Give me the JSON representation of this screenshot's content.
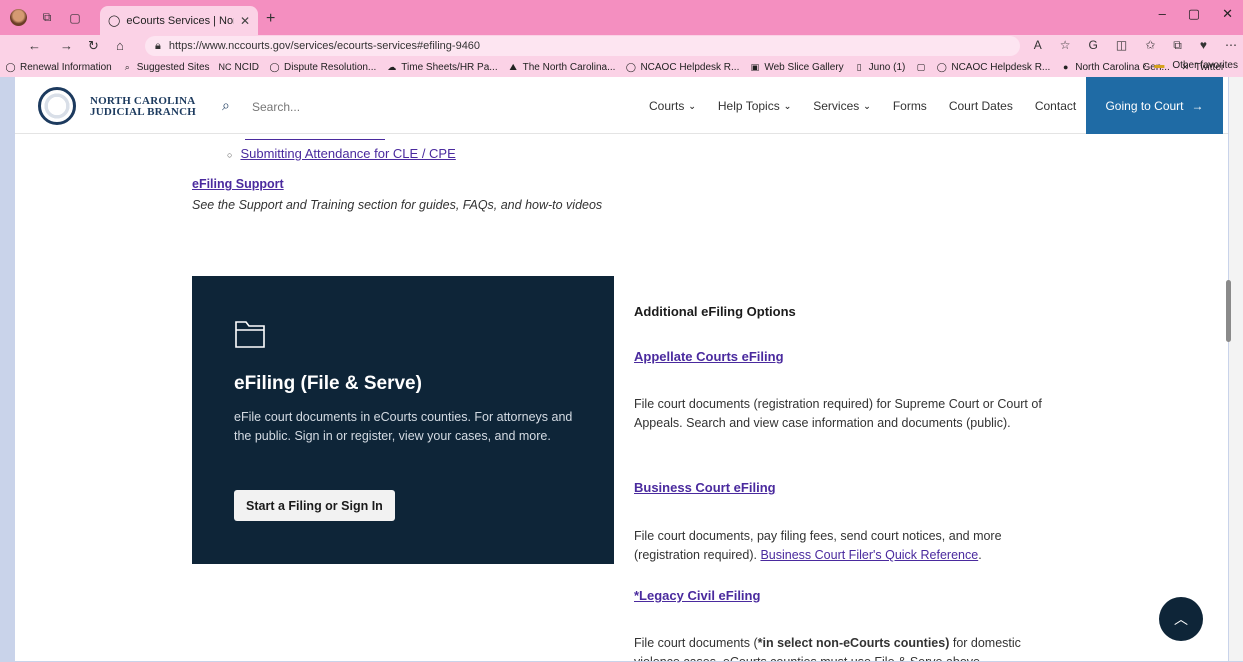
{
  "browser": {
    "tab_title": "eCourts Services | North Carolina",
    "url": "https://www.nccourts.gov/services/ecourts-services#efiling-9460",
    "favorites": [
      {
        "label": "Renewal Information",
        "icon": "globe-icon"
      },
      {
        "label": "Suggested Sites",
        "icon": "search-icon"
      },
      {
        "label": "NCID",
        "icon": "nc-icon"
      },
      {
        "label": "Dispute Resolution...",
        "icon": "globe-icon"
      },
      {
        "label": "Time Sheets/HR Pa...",
        "icon": "cloud-icon"
      },
      {
        "label": "The North Carolina...",
        "icon": "mountain-icon"
      },
      {
        "label": "NCAOC Helpdesk R...",
        "icon": "globe-icon"
      },
      {
        "label": "Web Slice Gallery",
        "icon": "slice-icon"
      },
      {
        "label": "Juno (1)",
        "icon": "page-icon"
      },
      {
        "label": "",
        "icon": "doc-icon"
      },
      {
        "label": "NCAOC Helpdesk R...",
        "icon": "globe-icon"
      },
      {
        "label": "North Carolina Gen...",
        "icon": "leaf-icon"
      },
      {
        "label": "Twitter",
        "icon": "x-icon"
      }
    ],
    "other_favorites": "Other favorites",
    "theme_color": "#f48fc0"
  },
  "header": {
    "brand_line1": "NORTH CAROLINA",
    "brand_line2": "JUDICIAL BRANCH",
    "search_placeholder": "Search...",
    "menu": [
      "Courts",
      "Help Topics",
      "Services",
      "Forms",
      "Court Dates",
      "Contact"
    ],
    "cta": "Going to Court"
  },
  "content": {
    "sub_link": "Submitting Attendance for CLE / CPE",
    "support_link": "eFiling Support",
    "support_desc": "See the Support and Training section for guides, FAQs, and how-to videos",
    "card": {
      "title": "eFiling (File & Serve)",
      "desc": "eFile court documents in eCourts counties. For attorneys and the public. Sign in or register, view your cases, and more.",
      "button": "Start a Filing or Sign In"
    },
    "options_heading": "Additional eFiling Options",
    "options": [
      {
        "title": "Appellate Courts eFiling",
        "desc": "File court documents (registration required) for Supreme Court or Court of Appeals. Search and view case information and documents (public)."
      },
      {
        "title": "Business Court eFiling",
        "desc_prefix": "File court documents, pay filing fees, send court notices, and more (registration required). ",
        "desc_link": "Business Court Filer's Quick Reference",
        "desc_suffix": "."
      },
      {
        "title": "*Legacy Civil eFiling",
        "desc_prefix": "File court documents (",
        "desc_bold": "*in select non-eCourts counties)",
        "desc_suffix": " for domestic violence cases. eCourts counties must use File & Serve above."
      }
    ]
  }
}
